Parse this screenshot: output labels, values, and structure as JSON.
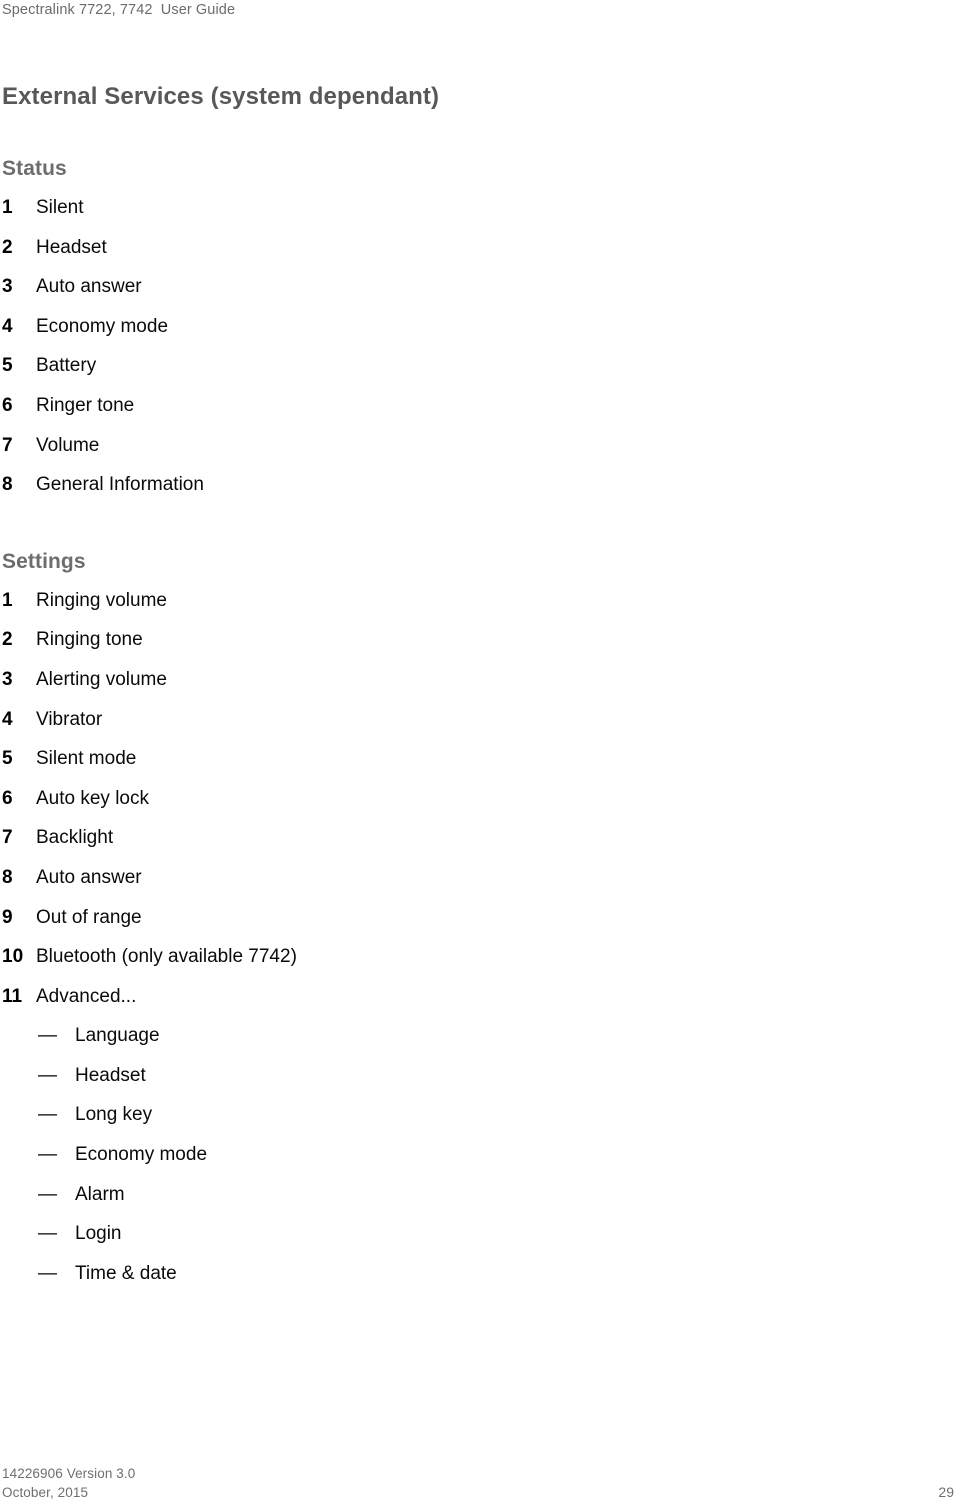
{
  "header": {
    "running_title": "Spectralink 7722, 7742  User Guide"
  },
  "main": {
    "title": "External Services (system dependant)",
    "sections": [
      {
        "heading": "Status",
        "list_type": "ordered",
        "items": [
          {
            "marker": "1",
            "label": "Silent"
          },
          {
            "marker": "2",
            "label": "Headset"
          },
          {
            "marker": "3",
            "label": "Auto answer"
          },
          {
            "marker": "4",
            "label": "Economy mode"
          },
          {
            "marker": "5",
            "label": "Battery"
          },
          {
            "marker": "6",
            "label": "Ringer tone"
          },
          {
            "marker": "7",
            "label": "Volume"
          },
          {
            "marker": "8",
            "label": "General Information"
          }
        ]
      },
      {
        "heading": "Settings",
        "list_type": "ordered",
        "items": [
          {
            "marker": "1",
            "label": "Ringing volume"
          },
          {
            "marker": "2",
            "label": "Ringing tone"
          },
          {
            "marker": "3",
            "label": "Alerting volume"
          },
          {
            "marker": "4",
            "label": "Vibrator"
          },
          {
            "marker": "5",
            "label": "Silent mode"
          },
          {
            "marker": "6",
            "label": "Auto key lock"
          },
          {
            "marker": "7",
            "label": "Backlight"
          },
          {
            "marker": "8",
            "label": "Auto answer"
          },
          {
            "marker": "9",
            "label": "Out of range"
          },
          {
            "marker": "10",
            "label": "Bluetooth (only available 7742)"
          },
          {
            "marker": "11",
            "label": "Advanced..."
          }
        ],
        "sub_items": {
          "marker": "—",
          "items": [
            {
              "label": "Language"
            },
            {
              "label": "Headset"
            },
            {
              "label": "Long key"
            },
            {
              "label": "Economy mode"
            },
            {
              "label": "Alarm"
            },
            {
              "label": "Login"
            },
            {
              "label": "Time & date"
            }
          ]
        }
      }
    ]
  },
  "footer": {
    "document_id": "14226906 Version 3.0",
    "date": "October, 2015",
    "page_number": "29"
  }
}
